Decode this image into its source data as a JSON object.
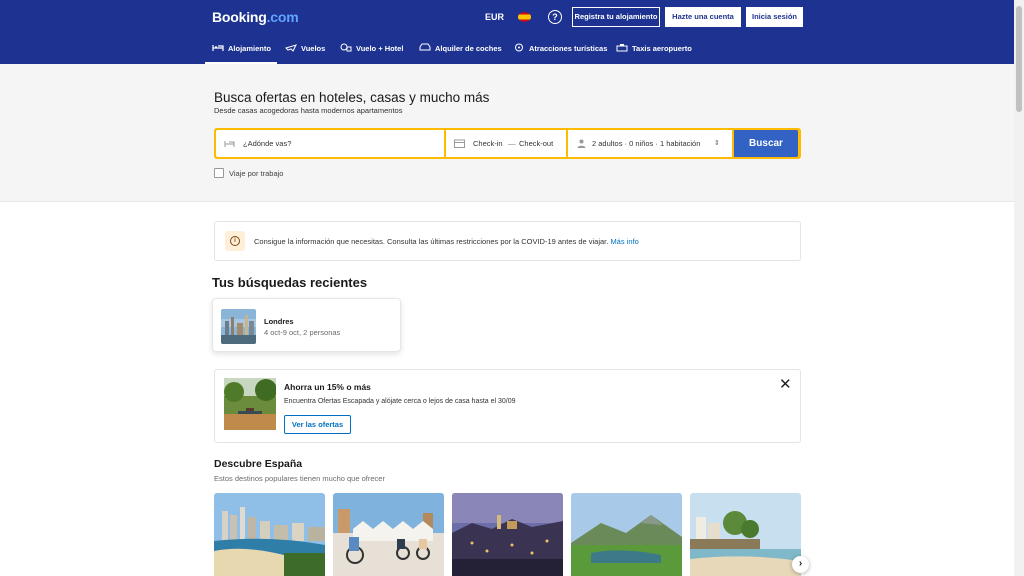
{
  "header": {
    "logo_main": "Booking",
    "logo_suffix": ".com",
    "currency": "EUR",
    "language_icon": "spain-flag-icon",
    "help_label": "?",
    "register_label": "Registra tu alojamiento",
    "create_account_label": "Hazte una cuenta",
    "login_label": "Inicia sesión",
    "brand_color": "#1e3391"
  },
  "nav": {
    "items": [
      {
        "label": "Alojamiento",
        "icon": "bed-icon",
        "active": true
      },
      {
        "label": "Vuelos",
        "icon": "plane-icon",
        "active": false
      },
      {
        "label": "Vuelo + Hotel",
        "icon": "plane-hotel-icon",
        "active": false
      },
      {
        "label": "Alquiler de coches",
        "icon": "car-icon",
        "active": false
      },
      {
        "label": "Atracciones turísticas",
        "icon": "attractions-icon",
        "active": false
      },
      {
        "label": "Taxis aeropuerto",
        "icon": "taxi-icon",
        "active": false
      }
    ]
  },
  "hero": {
    "title": "Busca ofertas en hoteles, casas y mucho más",
    "subtitle": "Desde casas acogedoras hasta modernos apartamentos"
  },
  "search": {
    "destination_placeholder": "¿Adónde vas?",
    "checkin": "Check-in",
    "date_separator": "—",
    "checkout": "Check-out",
    "occupancy": "2 adultos · 0 niños · 1 habitación",
    "button_label": "Buscar",
    "business_trip_label": "Viaje por trabajo",
    "highlight_color": "#febb02",
    "button_color": "#3162c4"
  },
  "notice": {
    "text": "Consigue la información que necesitas. Consulta las últimas restricciones por la COVID-19 antes de viajar.",
    "link": "Más info"
  },
  "recent": {
    "title": "Tus búsquedas recientes",
    "items": [
      {
        "city": "Londres",
        "details": "4 oct-9 oct, 2 personas"
      }
    ]
  },
  "deal": {
    "title": "Ahorra un 15% o más",
    "text": "Encuentra Ofertas Escapada y alójate cerca o lejos de casa hasta el 30/09",
    "button_label": "Ver las ofertas",
    "close_label": "✕"
  },
  "discover": {
    "title": "Descubre España",
    "subtitle": "Estos destinos populares tienen mucho que ofrecer",
    "next_label": "›"
  }
}
